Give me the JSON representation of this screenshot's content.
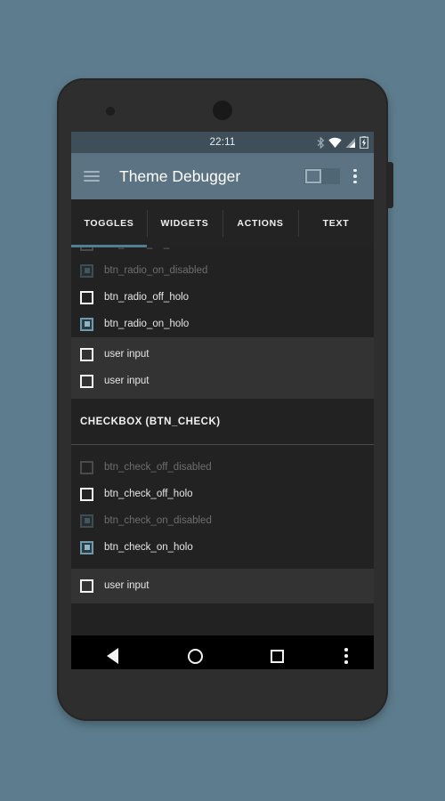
{
  "status_bar": {
    "clock": "22:11",
    "icons": [
      "bluetooth-icon",
      "wifi-icon",
      "cellular-signal-icon",
      "battery-charging-icon"
    ]
  },
  "toolbar": {
    "menu_icon": "hamburger-menu-icon",
    "title": "Theme Debugger",
    "switch_state": "off",
    "overflow_icon": "overflow-menu-icon"
  },
  "tabs": [
    {
      "label": "TOGGLES",
      "selected": true
    },
    {
      "label": "WIDGETS",
      "selected": false
    },
    {
      "label": "ACTIONS",
      "selected": false
    },
    {
      "label": "TEXT",
      "selected": false
    }
  ],
  "list": {
    "clipped_top_row": {
      "label": "btn_radio_off_disabled",
      "state": "off-disabled"
    },
    "radio_rows": [
      {
        "label": "btn_radio_on_disabled",
        "state": "on-disabled"
      },
      {
        "label": "btn_radio_off_holo",
        "state": "off-holo"
      },
      {
        "label": "btn_radio_on_holo",
        "state": "on-holo"
      }
    ],
    "radio_user_rows": [
      {
        "label": "user input",
        "state": "off-holo"
      },
      {
        "label": "user input",
        "state": "off-holo"
      }
    ],
    "section_header": "CHECKBOX (BTN_CHECK)",
    "check_rows": [
      {
        "label": "btn_check_off_disabled",
        "state": "off-disabled"
      },
      {
        "label": "btn_check_off_holo",
        "state": "off-holo"
      },
      {
        "label": "btn_check_on_disabled",
        "state": "on-disabled"
      },
      {
        "label": "btn_check_on_holo",
        "state": "on-holo"
      }
    ],
    "check_user_rows": [
      {
        "label": "user input",
        "state": "off-holo"
      }
    ]
  },
  "nav_bar": {
    "back": "back-triangle-icon",
    "home": "home-circle-icon",
    "recents": "recents-square-icon",
    "overflow": "overflow-menu-icon"
  },
  "colors": {
    "page_background": "#5d7d8e",
    "phone_body": "#2e2e2e",
    "status_bar": "#3f4f5a",
    "toolbar": "#5b7383",
    "tab_bar": "#232323",
    "tab_indicator": "#4f7f91",
    "list_background": "#222222",
    "user_row_background": "#333333",
    "accent_holo": "#6f9aab",
    "nav_bar": "#000000"
  }
}
